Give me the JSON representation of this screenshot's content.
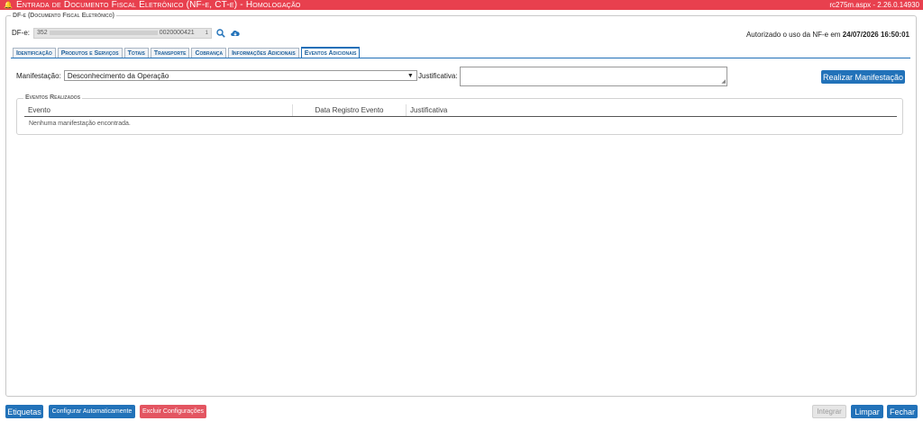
{
  "titlebar": {
    "title": "Entrada de Documento Fiscal Eletrônico (NF-e, CT-e)  - Homologação",
    "version": "rc275m.aspx - 2.26.0.14930"
  },
  "dfe_section": {
    "legend": "DF-e (Documento Fiscal Eletrônico)",
    "label": "DF-e:",
    "value_start": "352",
    "value_end": "0020000421",
    "value_suffix": "1",
    "autorizado_text": "Autorizado o uso da NF-e em",
    "autorizado_datetime": "24/07/2026 16:50:01"
  },
  "tabs": [
    {
      "label": "Identificação"
    },
    {
      "label": "Produtos e Serviços"
    },
    {
      "label": "Totais"
    },
    {
      "label": "Transporte"
    },
    {
      "label": "Cobrança"
    },
    {
      "label": "Informações Adicionais"
    },
    {
      "label": "Eventos Adicionais"
    }
  ],
  "manifestacao": {
    "label": "Manifestação:",
    "selected": "Desconhecimento da Operação",
    "justificativa_label": "Justificativa:",
    "justificativa_value": "",
    "submit_label": "Realizar Manifestação"
  },
  "eventos": {
    "legend": "Eventos Realizados",
    "columns": [
      "Evento",
      "Data Registro Evento",
      "Justificativa"
    ],
    "empty_message": "Nenhuma manifestação encontrada."
  },
  "footer": {
    "etiquetas": "Etiquetas",
    "configurar": "Configurar Automaticamente",
    "excluir": "Excluir Configurações",
    "integrar": "Integrar",
    "limpar": "Limpar",
    "fechar": "Fechar"
  },
  "colors": {
    "titlebar": "#e8404e",
    "primary": "#2272b9",
    "danger": "#e35561"
  }
}
